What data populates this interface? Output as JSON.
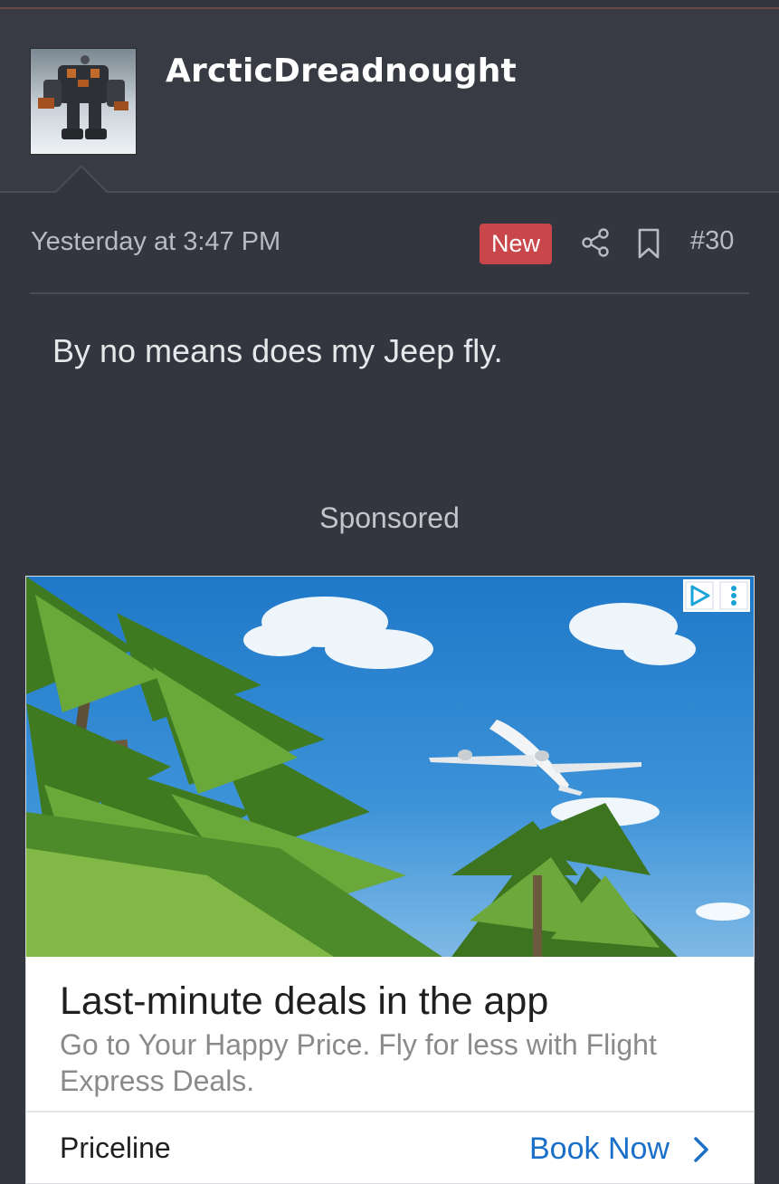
{
  "post": {
    "username": "ArcticDreadnought",
    "date": "Yesterday at 3:47 PM",
    "badge": "New",
    "number": "#30",
    "body": "By no means does my Jeep fly."
  },
  "ad": {
    "sponsored_label": "Sponsored",
    "title": "Last-minute deals in the app",
    "description": "Go to Your Happy Price. Fly for less with Flight Express Deals.",
    "advertiser": "Priceline",
    "cta": "Book Now"
  },
  "colors": {
    "background": "#33363e",
    "badge_new": "#c9474a",
    "cta": "#1a6fc9"
  },
  "icons": {
    "share": "share-icon",
    "bookmark": "bookmark-icon",
    "adchoices": "adchoices-icon",
    "ad_menu": "kebab-menu-icon",
    "cta_chevron": "chevron-right-icon"
  }
}
